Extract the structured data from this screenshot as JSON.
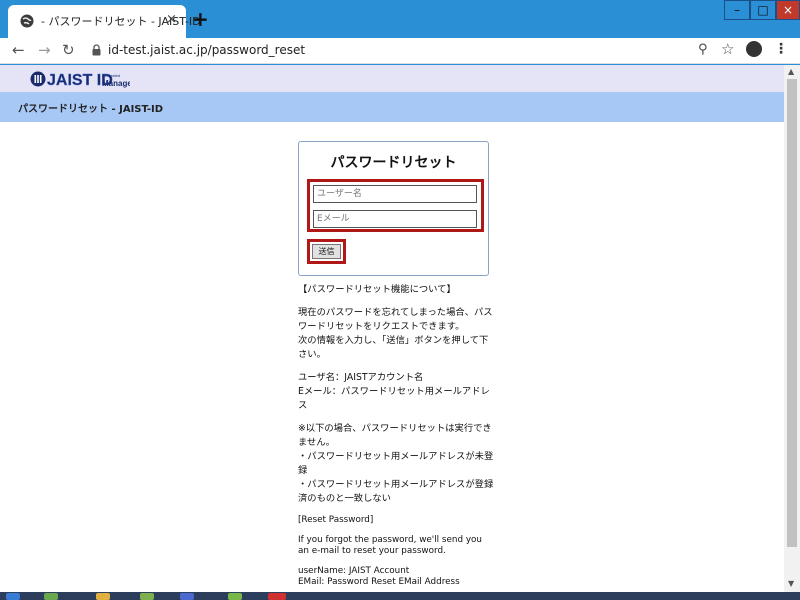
{
  "browser": {
    "tab_title": "- パスワードリセット - JAIST-ID",
    "tab_close": "×",
    "new_tab": "+",
    "url": "id-test.jaist.ac.jp/password_reset",
    "window_controls": {
      "minimize": "–",
      "maximize": "□",
      "close": "×"
    },
    "icons": [
      "globe-icon",
      "back-arrow-icon",
      "forward-arrow-icon",
      "reload-icon",
      "lock-icon",
      "zoom-icon",
      "star-icon",
      "profile-icon",
      "menu-icon"
    ],
    "accent_color": "#2b8fd6"
  },
  "page": {
    "logo_text": "JAIST ID Manager",
    "header_title": "パスワードリセット - JAIST-ID",
    "form": {
      "title": "パスワードリセット",
      "username_placeholder": "ユーザー名",
      "email_placeholder": "Eメール",
      "submit_label": "送信",
      "highlight_color": "#b01818"
    },
    "info": {
      "heading": "【パスワードリセット機能について】",
      "intro_1": "現在のパスワードを忘れてしまった場合、パスワードリセットをリクエストできます。",
      "intro_2": "次の情報を入力し、「送信」ボタンを押して下さい。",
      "field_user": "ユーザ名：JAISTアカウント名",
      "field_mail": "Eメール：パスワードリセット用メールアドレス",
      "note_title": "※以下の場合、パスワードリセットは実行できません。",
      "note_1": "・パスワードリセット用メールアドレスが未登録",
      "note_2": "・パスワードリセット用メールアドレスが登録済のものと一致しない",
      "en_heading": "[Reset Password]",
      "en_intro": "If you forgot the password, we'll send you an e-mail to reset your password.",
      "en_user": "userName: JAIST Account",
      "en_mail": "EMail: Password Reset EMail Address"
    }
  }
}
